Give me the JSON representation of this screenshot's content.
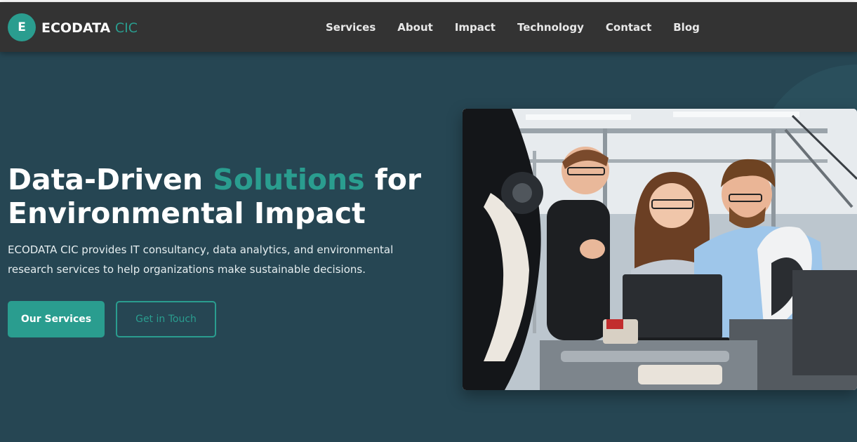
{
  "header": {
    "logo_letter": "E",
    "brand_main": "ECODATA",
    "brand_accent": "CIC",
    "nav": [
      "Services",
      "About",
      "Impact",
      "Technology",
      "Contact",
      "Blog"
    ]
  },
  "hero": {
    "title_part1": "Data-Driven ",
    "title_accent": "Solutions",
    "title_part2": " for Environmental Impact",
    "description": "ECODATA CIC provides IT consultancy, data analytics, and environmental research services to help organizations make sustainable decisions.",
    "primary_button": "Our Services",
    "secondary_button": "Get in Touch",
    "photo_alt": "Three people looking at a laptop in an engineering lab"
  },
  "colors": {
    "nav_bg": "#333333",
    "hero_bg": "#264653",
    "accent": "#2a9d8f",
    "text_light": "#ffffff"
  }
}
